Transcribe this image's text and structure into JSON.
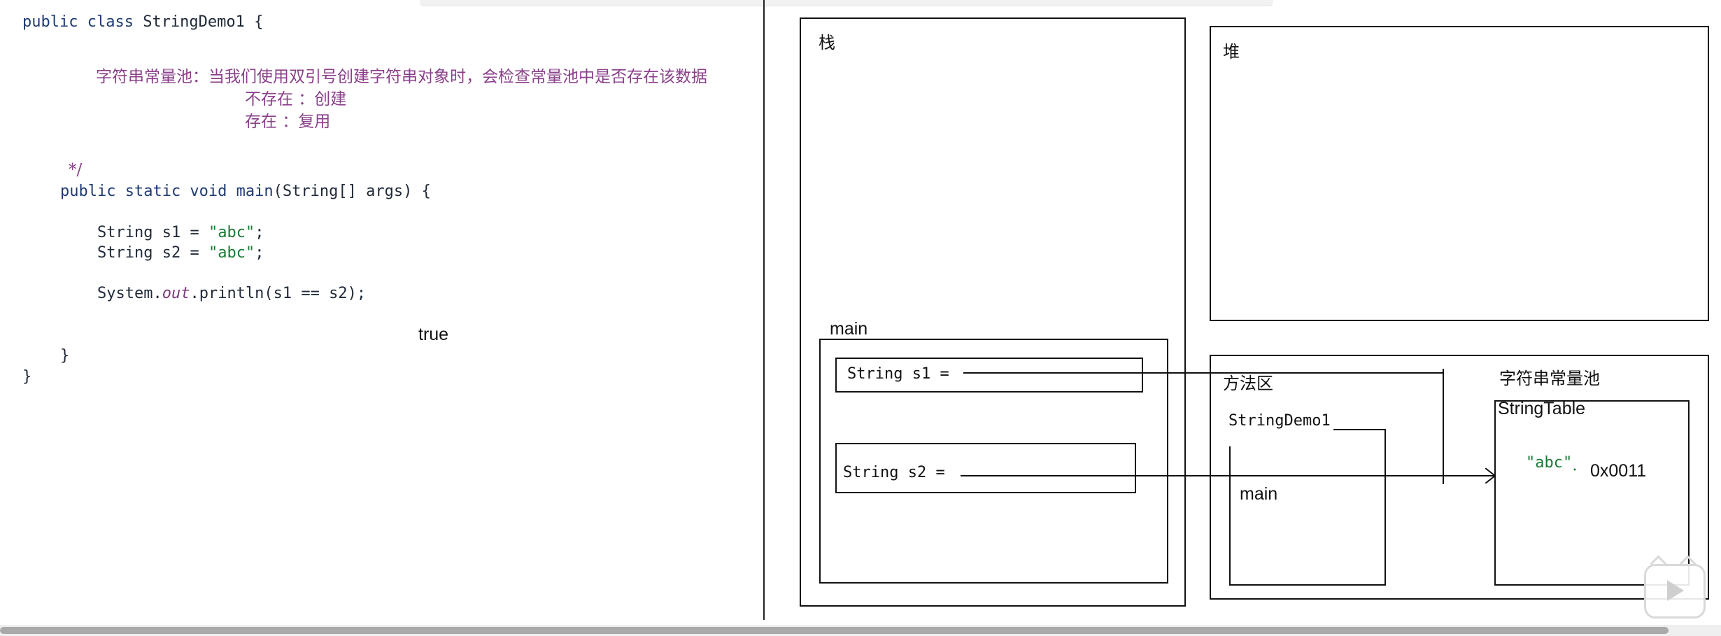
{
  "code": {
    "class_decl": {
      "kw": "public class",
      "name": " StringDemo1 {"
    },
    "comment_line1": "字符串常量池：当我们使用双引号创建字符串对象时，会检查常量池中是否存在该数据",
    "comment_line2": "不存在 ：创建",
    "comment_line3": "存在 ：复用",
    "comment_end": "*/",
    "main_decl": {
      "kw": "public static void",
      "name": " main",
      "rest": "(String[] args) {"
    },
    "s1_decl": {
      "prefix": "String s1 = ",
      "literal": "\"abc\"",
      "suffix": ";"
    },
    "s2_decl": {
      "prefix": "String s2 = ",
      "literal": "\"abc\"",
      "suffix": ";"
    },
    "println": {
      "prefix": "System.",
      "field": "out",
      "suffix": ".println(s1 == s2);"
    },
    "output": "true",
    "close_method": "}",
    "close_class": "}"
  },
  "diagram": {
    "stack_label": "栈",
    "heap_label": "堆",
    "main_frame_label": "main",
    "s1_label": "String s1 =",
    "s2_label": "String s2 =",
    "method_area_label": "方法区",
    "string_pool_label": "字符串常量池",
    "class_box_label": "StringDemo1",
    "class_main_label": "main",
    "string_table_label": "StringTable",
    "pool_string": "\"abc\"",
    "pool_address": "0x0011"
  },
  "colors": {
    "keyword": "#1f3b73",
    "string_literal": "#1a7a35",
    "comment": "#8a3f8a",
    "italic_field": "#7a3a7a",
    "line": "#111111"
  }
}
